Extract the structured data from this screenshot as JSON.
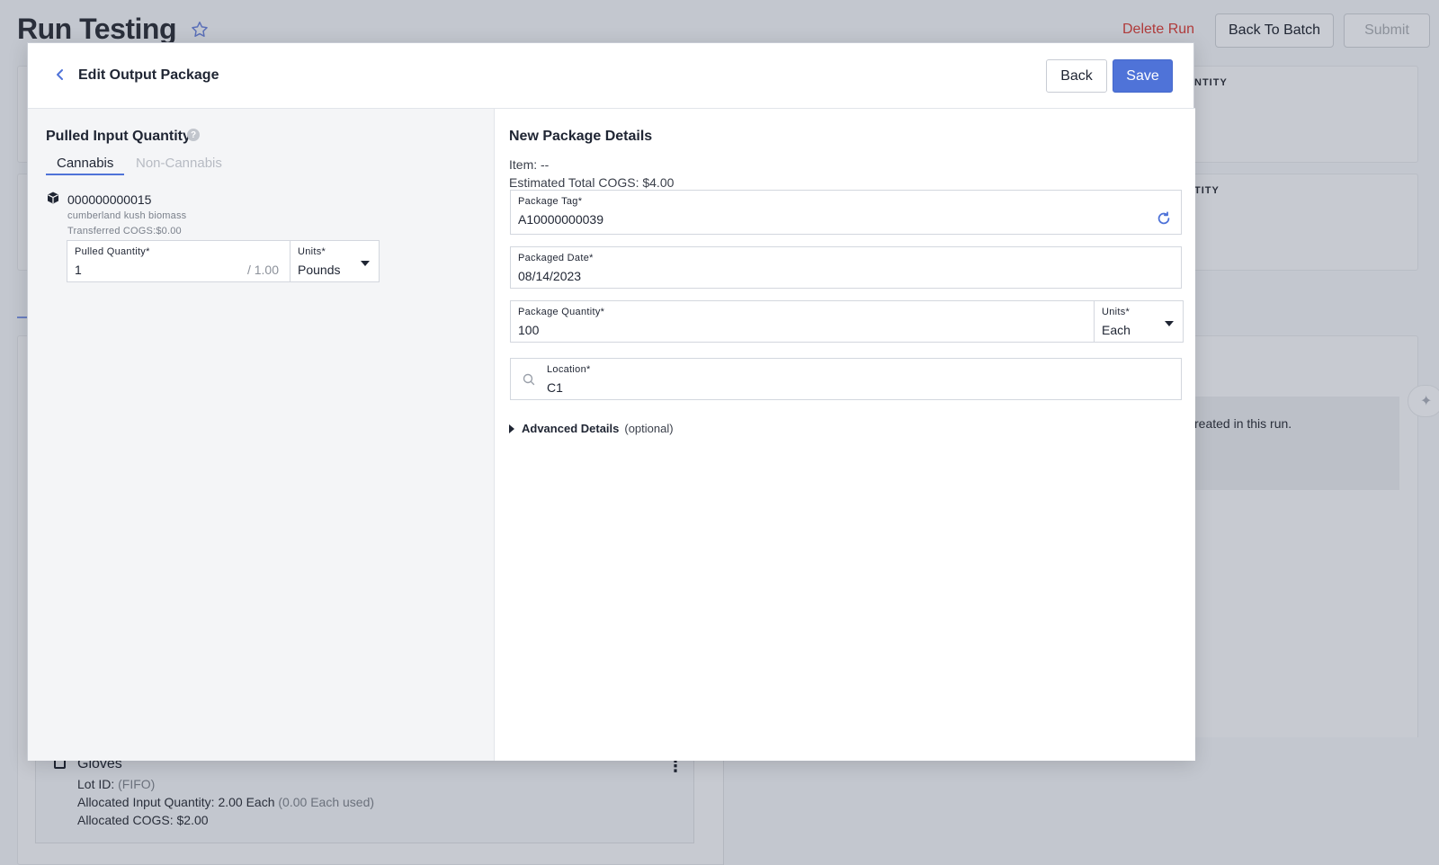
{
  "background": {
    "title": "Run Testing",
    "delete_label": "Delete Run",
    "back_to_batch_label": "Back To Batch",
    "submit_label": "Submit",
    "card1_label": "NTITY",
    "card2_label": "TITY",
    "info_text": "reated in this run.",
    "gloves": {
      "title": "Gloves",
      "lot_label": "Lot ID:",
      "lot_value": "(FIFO)",
      "allocated_label": "Allocated Input Quantity:",
      "allocated_value": "2.00 Each",
      "allocated_used": "(0.00 Each used)",
      "cogs_label": "Allocated COGS:",
      "cogs_value": "$2.00"
    }
  },
  "modal": {
    "title": "Edit Output Package",
    "back_label": "Back",
    "save_label": "Save",
    "left": {
      "title": "Pulled Input Quantity",
      "tabs": [
        {
          "label": "Cannabis",
          "active": true
        },
        {
          "label": "Non-Cannabis",
          "active": false
        }
      ],
      "package": {
        "id": "000000000015",
        "name": "cumberland kush biomass",
        "cogs": "Transferred COGS:$0.00"
      },
      "pulled_quantity": {
        "label": "Pulled Quantity*",
        "value": "1",
        "max": "/ 1.00"
      },
      "units": {
        "label": "Units*",
        "value": "Pounds"
      }
    },
    "right": {
      "title": "New Package Details",
      "item_line": "Item: --",
      "cogs_line": "Estimated Total COGS: $4.00",
      "package_tag": {
        "label": "Package Tag*",
        "value": "A10000000039"
      },
      "packaged_date": {
        "label": "Packaged Date*",
        "value": "08/14/2023"
      },
      "package_quantity": {
        "label": "Package Quantity*",
        "value": "100"
      },
      "units": {
        "label": "Units*",
        "value": "Each"
      },
      "location": {
        "label": "Location*",
        "value": "C1"
      },
      "advanced": {
        "label": "Advanced Details",
        "optional": "(optional)"
      }
    }
  },
  "colors": {
    "accent": "#4f73d8",
    "danger": "#b03b3b"
  }
}
